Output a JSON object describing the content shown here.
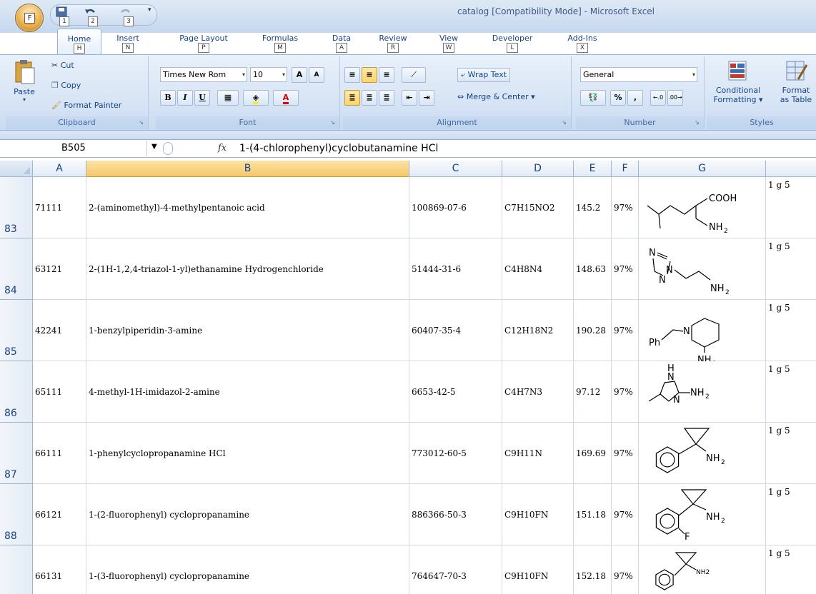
{
  "app": {
    "title": "catalog  [Compatibility Mode] - Microsoft Excel",
    "office_key": "F",
    "qat_keys": [
      "1",
      "2",
      "3"
    ]
  },
  "tabs": [
    {
      "label": "Home",
      "key": "H"
    },
    {
      "label": "Insert",
      "key": "N"
    },
    {
      "label": "Page Layout",
      "key": "P"
    },
    {
      "label": "Formulas",
      "key": "M"
    },
    {
      "label": "Data",
      "key": "A"
    },
    {
      "label": "Review",
      "key": "R"
    },
    {
      "label": "View",
      "key": "W"
    },
    {
      "label": "Developer",
      "key": "L"
    },
    {
      "label": "Add-Ins",
      "key": "X"
    }
  ],
  "ribbon": {
    "clipboard": {
      "label": "Clipboard",
      "paste": "Paste",
      "cut": "Cut",
      "copy": "Copy",
      "format_painter": "Format Painter"
    },
    "font": {
      "label": "Font",
      "font_name": "Times New Rom",
      "font_size": "10",
      "bold": "B",
      "italic": "I",
      "underline": "U"
    },
    "alignment": {
      "label": "Alignment",
      "wrap_text": "Wrap Text",
      "merge_center": "Merge & Center"
    },
    "number": {
      "label": "Number",
      "format": "General",
      "percent": "%",
      "comma": ","
    },
    "styles": {
      "label": "Styles",
      "conditional": "Conditional",
      "formatting": "Formatting",
      "format_as": "Format",
      "as_table": "as Table"
    }
  },
  "formula_bar": {
    "name_box": "B505",
    "fx": "fx",
    "formula": "1-(4-chlorophenyl)cyclobutanamine HCl"
  },
  "columns": [
    "A",
    "B",
    "C",
    "D",
    "E",
    "F",
    "G"
  ],
  "selected_column": "B",
  "rows": [
    {
      "row": "83",
      "id": "71111",
      "name": "2-(aminomethyl)-4-methylpentanoic acid",
      "cas": "100869-07-6",
      "formula": "C7H15NO2",
      "mw": "145.2",
      "purity": "97%",
      "pack": "1  g 5"
    },
    {
      "row": "84",
      "id": "63121",
      "name": "2-(1H-1,2,4-triazol-1-yl)ethanamine Hydrogenchloride",
      "cas": "51444-31-6",
      "formula": "C4H8N4",
      "mw": "148.63",
      "purity": "97%",
      "pack": "1  g 5"
    },
    {
      "row": "85",
      "id": "42241",
      "name": "1-benzylpiperidin-3-amine",
      "cas": "60407-35-4",
      "formula": "C12H18N2",
      "mw": "190.28",
      "purity": "97%",
      "pack": "1  g 5"
    },
    {
      "row": "86",
      "id": "65111",
      "name": "4-methyl-1H-imidazol-2-amine",
      "cas": "6653-42-5",
      "formula": "C4H7N3",
      "mw": "97.12",
      "purity": "97%",
      "pack": "1  g 5"
    },
    {
      "row": "87",
      "id": "66111",
      "name": "1-phenylcyclopropanamine HCl",
      "cas": "773012-60-5",
      "formula": "C9H11N",
      "mw": "169.69",
      "purity": "97%",
      "pack": "1  g 5"
    },
    {
      "row": "88",
      "id": "66121",
      "name": "1-(2-fluorophenyl) cyclopropanamine",
      "cas": "886366-50-3",
      "formula": "C9H10FN",
      "mw": "151.18",
      "purity": "97%",
      "pack": "1  g 5"
    },
    {
      "row": "",
      "id": "66131",
      "name": "1-(3-fluorophenyl) cyclopropanamine",
      "cas": "764647-70-3",
      "formula": "C9H10FN",
      "mw": "152.18",
      "purity": "97%",
      "pack": "1  g 5"
    }
  ],
  "structure_labels": {
    "cooh": "COOH",
    "nh2": "NH",
    "sub2": "2",
    "n": "N",
    "h": "H",
    "ph": "Ph",
    "f": "F"
  },
  "colors": {
    "accent": "#15428b",
    "selected_header": "#f5c76b"
  }
}
